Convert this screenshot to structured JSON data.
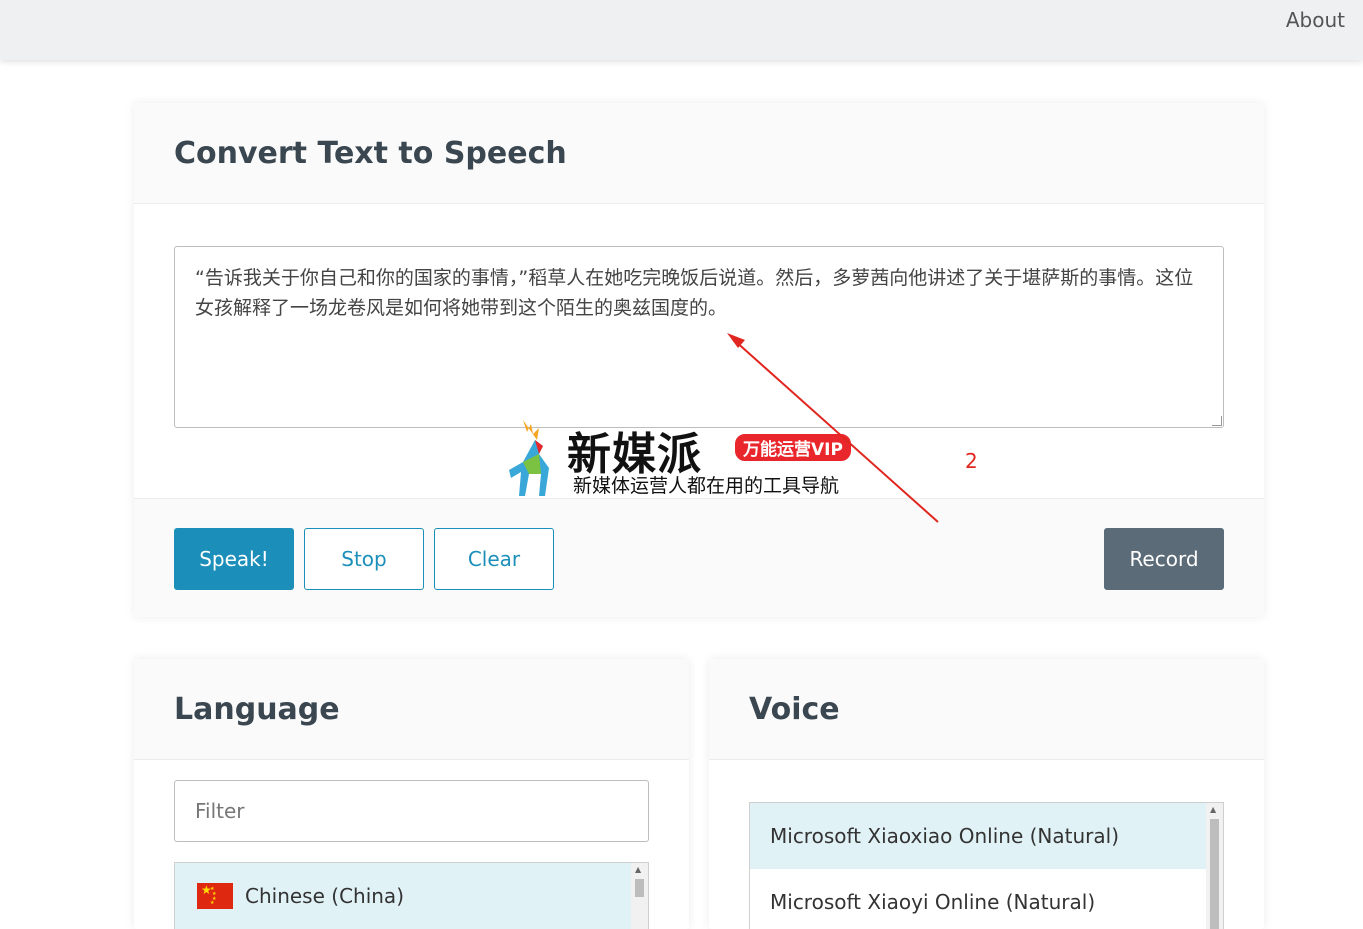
{
  "nav": {
    "about": "About"
  },
  "main": {
    "title": "Convert Text to Speech",
    "text": "“告诉我关于你自己和你的国家的事情，”稻草人在她吃完晚饭后说道。然后，多萝茜向他讲述了关于堪萨斯的事情。这位女孩解释了一场龙卷风是如何将她带到这个陌生的奥兹国度的。",
    "buttons": {
      "speak": "Speak!",
      "stop": "Stop",
      "clear": "Clear",
      "record": "Record"
    }
  },
  "language": {
    "title": "Language",
    "filter_placeholder": "Filter",
    "items": [
      {
        "label": "Chinese (China)",
        "flag": "china-flag"
      }
    ]
  },
  "voice": {
    "title": "Voice",
    "items": [
      {
        "label": "Microsoft Xiaoxiao Online (Natural)",
        "selected": true
      },
      {
        "label": "Microsoft Xiaoyi Online (Natural)",
        "selected": false
      }
    ]
  },
  "watermark": {
    "brand": "新媒派",
    "badge": "万能运营VIP",
    "slogan": "新媒体运营人都在用的工具导航"
  },
  "annotation": {
    "number": "2",
    "color": "#e0261f"
  },
  "colors": {
    "primary": "#1b8fb9",
    "secondary": "#5b6b78",
    "selected_bg": "#e1f2f6"
  }
}
